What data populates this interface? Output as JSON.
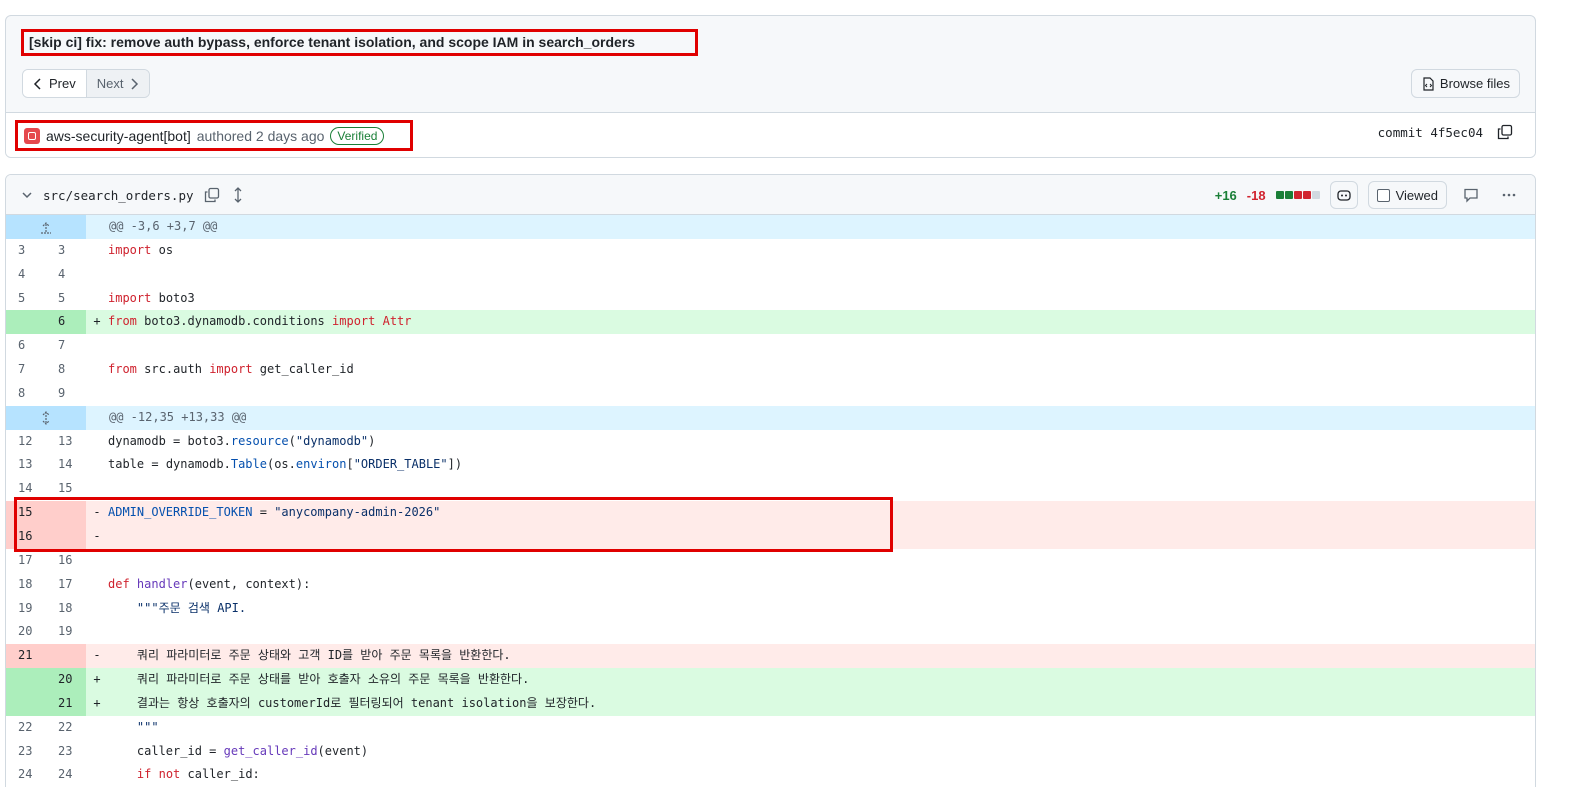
{
  "commit": {
    "title": "[skip ci] fix: remove auth bypass, enforce tenant isolation, and scope IAM in search_orders",
    "prev_label": "Prev",
    "next_label": "Next",
    "browse_label": "Browse files",
    "author": "aws-security-agent[bot]",
    "authored_text": "authored 2 days ago",
    "verified_label": "Verified",
    "sha_label": "commit 4f5ec04"
  },
  "file": {
    "path": "src/search_orders.py",
    "additions": "+16",
    "deletions": "-18",
    "viewed_label": "Viewed"
  },
  "colors": {
    "highlight_box": "#e00000",
    "add_bg": "#dafbe1",
    "del_bg": "#ffebe9",
    "hunk_bg": "#ddf4ff"
  },
  "diff": {
    "hunk1": "@@ -3,6 +3,7 @@",
    "hunk2": "@@ -12,35 +13,33 @@",
    "lines": [
      {
        "old": "3",
        "new": "3",
        "sign": "",
        "code": "import os"
      },
      {
        "old": "4",
        "new": "4",
        "sign": "",
        "code": ""
      },
      {
        "old": "5",
        "new": "5",
        "sign": "",
        "code": "import boto3"
      },
      {
        "old": "",
        "new": "6",
        "sign": "+",
        "code": "from boto3.dynamodb.conditions import Attr"
      },
      {
        "old": "6",
        "new": "7",
        "sign": "",
        "code": ""
      },
      {
        "old": "7",
        "new": "8",
        "sign": "",
        "code": "from src.auth import get_caller_id"
      },
      {
        "old": "8",
        "new": "9",
        "sign": "",
        "code": ""
      },
      {
        "old": "12",
        "new": "13",
        "sign": "",
        "code": "dynamodb = boto3.resource(\"dynamodb\")"
      },
      {
        "old": "13",
        "new": "14",
        "sign": "",
        "code": "table = dynamodb.Table(os.environ[\"ORDER_TABLE\"])"
      },
      {
        "old": "14",
        "new": "15",
        "sign": "",
        "code": ""
      },
      {
        "old": "15",
        "new": "",
        "sign": "-",
        "code": "ADMIN_OVERRIDE_TOKEN = \"anycompany-admin-2026\""
      },
      {
        "old": "16",
        "new": "",
        "sign": "-",
        "code": ""
      },
      {
        "old": "17",
        "new": "16",
        "sign": "",
        "code": ""
      },
      {
        "old": "18",
        "new": "17",
        "sign": "",
        "code": "def handler(event, context):"
      },
      {
        "old": "19",
        "new": "18",
        "sign": "",
        "code": "    \"\"\"주문 검색 API."
      },
      {
        "old": "20",
        "new": "19",
        "sign": "",
        "code": ""
      },
      {
        "old": "21",
        "new": "",
        "sign": "-",
        "code": "    쿼리 파라미터로 주문 상태와 고객 ID를 받아 주문 목록을 반환한다."
      },
      {
        "old": "",
        "new": "20",
        "sign": "+",
        "code": "    쿼리 파라미터로 주문 상태를 받아 호출자 소유의 주문 목록을 반환한다."
      },
      {
        "old": "",
        "new": "21",
        "sign": "+",
        "code": "    결과는 항상 호출자의 customerId로 필터링되어 tenant isolation을 보장한다."
      },
      {
        "old": "22",
        "new": "22",
        "sign": "",
        "code": "    \"\"\""
      },
      {
        "old": "23",
        "new": "23",
        "sign": "",
        "code": "    caller_id = get_caller_id(event)"
      },
      {
        "old": "24",
        "new": "24",
        "sign": "",
        "code": "    if not caller_id:"
      }
    ]
  }
}
